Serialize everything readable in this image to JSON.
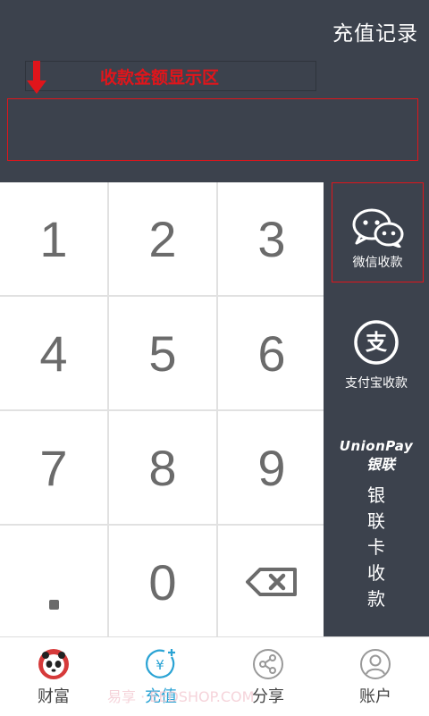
{
  "header": {
    "records_label": "充值记录"
  },
  "annotation": {
    "text": "收款金额显示区",
    "color": "#e0151b"
  },
  "amount": {
    "value": ""
  },
  "keypad": {
    "keys": [
      "1",
      "2",
      "3",
      "4",
      "5",
      "6",
      "7",
      "8",
      "9",
      ".",
      "0",
      "backspace"
    ]
  },
  "payments": {
    "wechat_label": "微信收款",
    "alipay_label": "支付宝收款",
    "alipay_glyph": "支",
    "unionpay_logo_en": "UnionPay",
    "unionpay_logo_cn": "银联",
    "unionpay_label_chars": [
      "银",
      "联",
      "卡",
      "收",
      "款"
    ]
  },
  "tabs": [
    {
      "label": "财富",
      "icon": "panda-avatar-icon",
      "active": false
    },
    {
      "label": "充值",
      "icon": "yen-recharge-icon",
      "active": true
    },
    {
      "label": "分享",
      "icon": "share-icon",
      "active": false
    },
    {
      "label": "账户",
      "icon": "user-account-icon",
      "active": false
    }
  ],
  "watermark": "易享 · EEDSHOP.COM",
  "colors": {
    "background": "#3c424d",
    "accent": "#2aa3d4",
    "annotation": "#e0151b"
  }
}
